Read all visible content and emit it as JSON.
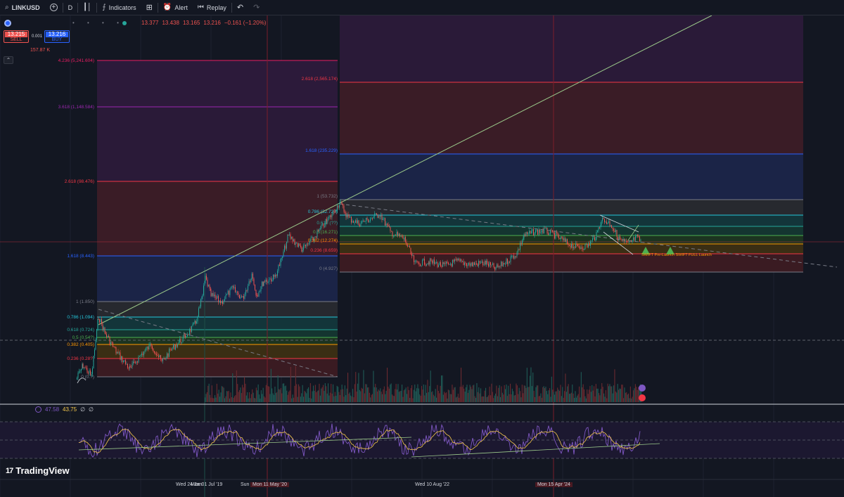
{
  "toolbar": {
    "symbol": "LINKUSD",
    "interval": "D",
    "indicators_label": "Indicators",
    "alert_label": "Alert",
    "replay_label": "Replay"
  },
  "legend": {
    "open": "13.377",
    "high": "13.438",
    "low": "13.165",
    "close": "13.216",
    "change": "−0.161 (−1.20%)",
    "dots": "• • • •"
  },
  "trade": {
    "sell_price": "13.215",
    "sell_label": "SELL",
    "buy_price": "13.216",
    "buy_label": "BUY",
    "spread": "0.001",
    "volume": "157.87 K"
  },
  "fib_left": {
    "levels": [
      {
        "label": "4.236 (5,241.604)",
        "color": "#e91e63"
      },
      {
        "label": "3.618 (1,148.584)",
        "color": "#9c27b0"
      },
      {
        "label": "2.618 (98.476)",
        "color": "#f23645"
      },
      {
        "label": "1.618 (8.443)",
        "color": "#2962ff"
      },
      {
        "label": "1 (1.850)",
        "color": "#787b86"
      },
      {
        "label": "0.786 (1.094)",
        "color": "#26c6da"
      },
      {
        "label": "0.618 (0.724)",
        "color": "#26a69a"
      },
      {
        "label": "0.5 (0.54?)",
        "color": "#4caf50"
      },
      {
        "label": "0.382 (0.405)",
        "color": "#ff9800"
      },
      {
        "label": "0.236 (0.28?)",
        "color": "#f23645"
      },
      {
        "label": "0 (0.?)",
        "color": "#787b86"
      }
    ]
  },
  "fib_right": {
    "levels": [
      {
        "label": "2.618 (2,565.174)",
        "color": "#f23645"
      },
      {
        "label": "1.618 (235.229)",
        "color": "#2962ff"
      },
      {
        "label": "1 (53.732)",
        "color": "#787b86"
      },
      {
        "label": "0.786 (32.72?)",
        "color": "#26c6da"
      },
      {
        "label": "0.618 (??)",
        "color": "#26a69a"
      },
      {
        "label": "0.5 (16.271)",
        "color": "#4caf50"
      },
      {
        "label": "0.382 (12.274)",
        "color": "#ff9800"
      },
      {
        "label": "0.236 (8.659)",
        "color": "#f23645"
      },
      {
        "label": "0 (4.927)",
        "color": "#787b86"
      }
    ]
  },
  "annotations": {
    "launch_text": "SWIFT Pre-Launch  SWIFT FULL Launch"
  },
  "rsi": {
    "value": "47.58",
    "ma": "43.75",
    "v3": "∅",
    "v4": "∅"
  },
  "dates": {
    "d1": "Wed 24 Jan",
    "d2": "Mon 01 Jul '19",
    "d3": "Sun 15 Mar",
    "d4": "Mon 11 May '20",
    "d5": "Wed 10 Aug '22",
    "d6": "Mon 15 Apr '24"
  },
  "brand": {
    "logo_mark": "17",
    "name": "TradingView"
  },
  "colors": {
    "background": "#131722",
    "up": "#26a69a",
    "down": "#ef5350",
    "rsi_line": "#7e57c2",
    "rsi_ma": "#f5c84c"
  }
}
